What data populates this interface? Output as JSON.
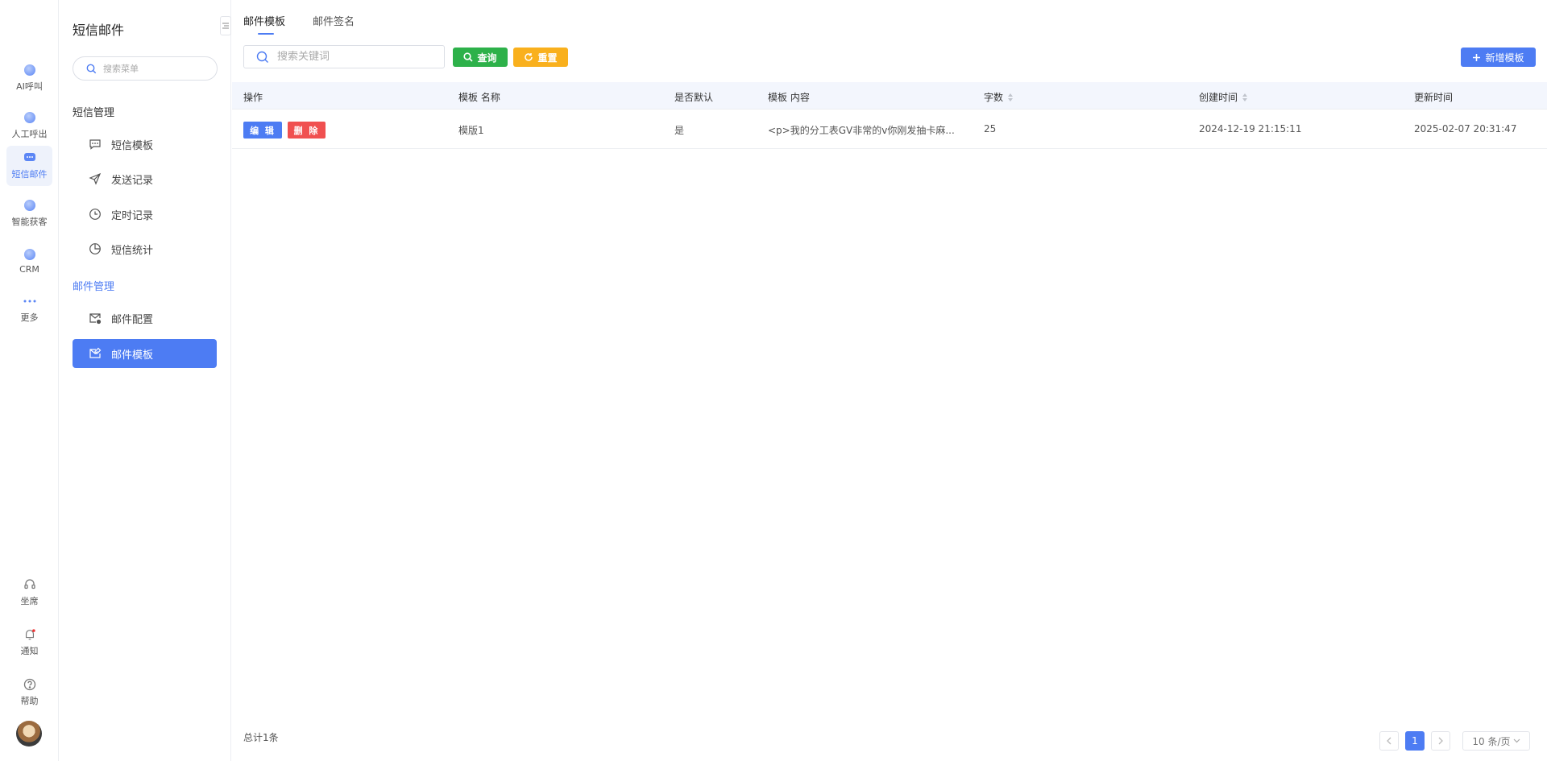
{
  "rail": {
    "items": [
      {
        "label": "AI呼叫"
      },
      {
        "label": "人工呼出"
      },
      {
        "label": "短信邮件"
      },
      {
        "label": "智能获客"
      },
      {
        "label": "CRM"
      },
      {
        "label": "更多"
      }
    ],
    "bottom": [
      {
        "label": "坐席"
      },
      {
        "label": "通知"
      },
      {
        "label": "帮助"
      }
    ]
  },
  "sidebar": {
    "title": "短信邮件",
    "search_placeholder": "搜索菜单",
    "group_sms": "短信管理",
    "sms_items": [
      {
        "label": "短信模板"
      },
      {
        "label": "发送记录"
      },
      {
        "label": "定时记录"
      },
      {
        "label": "短信统计"
      }
    ],
    "group_mail": "邮件管理",
    "mail_items": [
      {
        "label": "邮件配置"
      },
      {
        "label": "邮件模板"
      }
    ]
  },
  "tabs": [
    {
      "label": "邮件模板"
    },
    {
      "label": "邮件签名"
    }
  ],
  "toolbar": {
    "search_placeholder": "搜索关键词",
    "query_label": "查询",
    "reset_label": "重置",
    "add_label": "新增模板"
  },
  "table": {
    "headers": [
      "操作",
      "模板 名称",
      "是否默认",
      "模板 内容",
      "字数",
      "创建时间",
      "更新时间"
    ],
    "edit_label": "编 辑",
    "delete_label": "删 除",
    "rows": [
      {
        "name": "模版1",
        "is_default": "是",
        "content": "<p>我的分工表GV非常的v你刚发抽卡麻...",
        "word_count": "25",
        "created": "2024-12-19 21:15:11",
        "updated": "2025-02-07 20:31:47"
      }
    ]
  },
  "footer": {
    "total": "总计1条",
    "current_page": "1",
    "page_size": "10 条/页"
  },
  "colors": {
    "accent": "#4d7cf3",
    "query": "#2db14a",
    "reset": "#f9b01d",
    "danger": "#f05050"
  }
}
